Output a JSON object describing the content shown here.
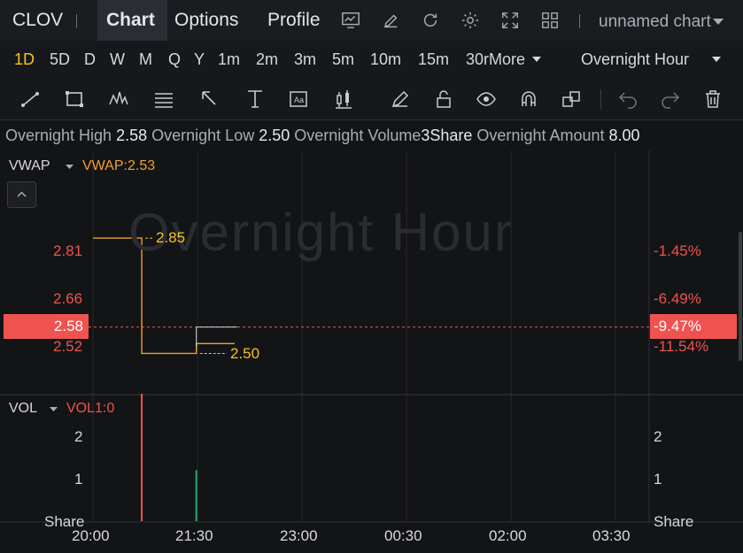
{
  "header": {
    "symbol": "CLOV",
    "tabs": [
      {
        "label": "Chart"
      },
      {
        "label": "Options"
      },
      {
        "label": "Profile"
      }
    ],
    "chart_name": "unnamed chart"
  },
  "timeframes": {
    "items": [
      "1D",
      "5D",
      "D",
      "W",
      "M",
      "Q",
      "Y",
      "1m",
      "2m",
      "3m",
      "5m",
      "10m",
      "15m",
      "30r"
    ],
    "active": "1D",
    "more_label": "More",
    "session_label": "Overnight Hour"
  },
  "info": {
    "high_label": "Overnight High",
    "high_value": "2.58",
    "low_label": "Overnight Low",
    "low_value": "2.50",
    "volume_label": "Overnight Volume",
    "volume_value": "3Share",
    "amount_label": "Overnight Amount",
    "amount_value": "8.00"
  },
  "price_pane": {
    "indicator": "VWAP",
    "indicator_value": "VWAP:2.53",
    "watermark": "Overnight Hour",
    "left_ticks": [
      "2.81",
      "2.66",
      "2.52"
    ],
    "right_ticks": [
      "-1.45%",
      "-6.49%",
      "-11.54%"
    ],
    "current_price_label": "2.58",
    "current_pct_label": "-9.47%",
    "high_marker": "2.85",
    "low_marker": "2.50"
  },
  "volume_pane": {
    "indicator": "VOL",
    "indicator_value": "VOL1:0",
    "left_ticks": [
      "2",
      "1"
    ],
    "right_ticks": [
      "2",
      "1"
    ],
    "unit_left": "Share",
    "unit_right": "Share"
  },
  "x_axis": {
    "labels": [
      "20:00",
      "21:30",
      "23:00",
      "00:30",
      "02:00",
      "03:30"
    ]
  },
  "colors": {
    "up": "#26a66b",
    "down": "#ef5350",
    "vwap": "#f0a030",
    "accent": "#f5c518",
    "current_price_bg": "#ef5350"
  },
  "chart_data": {
    "type": "line",
    "x_labels": [
      "20:00",
      "21:30",
      "23:00",
      "00:30",
      "02:00",
      "03:30"
    ],
    "series": [
      {
        "name": "VWAP",
        "x": [
          "20:00",
          "20:42",
          "20:42",
          "21:29",
          "21:29",
          "22:02"
        ],
        "values": [
          2.85,
          2.85,
          2.5,
          2.5,
          2.53,
          2.53
        ]
      }
    ],
    "volume": [
      {
        "x": "20:42",
        "value": 3,
        "direction": "down"
      },
      {
        "x": "21:29",
        "value": 1.2,
        "direction": "up"
      }
    ],
    "current_price": 2.58,
    "high": 2.85,
    "low": 2.5,
    "ylim": [
      2.45,
      2.95
    ]
  }
}
